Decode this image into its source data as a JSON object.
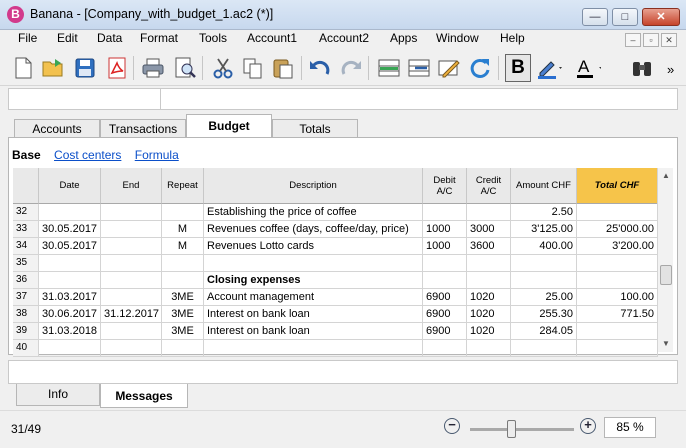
{
  "window": {
    "title": "Banana - [Company_with_budget_1.ac2 (*)]",
    "icon_letter": "B",
    "buttons": {
      "minimize": "—",
      "maximize": "□",
      "close": "✕"
    }
  },
  "menu": [
    "File",
    "Edit",
    "Data",
    "Format",
    "Tools",
    "Account1",
    "Account2",
    "Apps",
    "Window",
    "Help"
  ],
  "mdi_buttons": [
    "–",
    "▫",
    "✕"
  ],
  "toolbar": {
    "overflow": "»"
  },
  "tabs": [
    "Accounts",
    "Transactions",
    "Budget",
    "Totals"
  ],
  "active_tab": "Budget",
  "views": {
    "base": "Base",
    "links": [
      "Cost centers",
      "Formula"
    ]
  },
  "table": {
    "columns": [
      "",
      "Date",
      "End",
      "Repeat",
      "Description",
      "Debit A/C",
      "Credit A/C",
      "Amount CHF",
      "Total CHF"
    ],
    "rows": [
      [
        "32",
        "",
        "",
        "",
        "Establishing the price of coffee",
        "",
        "",
        "2.50",
        ""
      ],
      [
        "33",
        "30.05.2017",
        "",
        "M",
        "Revenues coffee (days, coffee/day, price)",
        "1000",
        "3000",
        "3'125.00",
        "25'000.00"
      ],
      [
        "34",
        "30.05.2017",
        "",
        "M",
        "Revenues Lotto cards",
        "1000",
        "3600",
        "400.00",
        "3'200.00"
      ],
      [
        "35",
        "",
        "",
        "",
        "",
        "",
        "",
        "",
        ""
      ],
      [
        "36",
        "",
        "",
        "",
        "Closing expenses",
        "",
        "",
        "",
        ""
      ],
      [
        "37",
        "31.03.2017",
        "",
        "3ME",
        "Account management",
        "6900",
        "1020",
        "25.00",
        "100.00"
      ],
      [
        "38",
        "30.06.2017",
        "31.12.2017",
        "3ME",
        "Interest on bank loan",
        "6900",
        "1020",
        "255.30",
        "771.50"
      ],
      [
        "39",
        "31.03.2018",
        "",
        "3ME",
        "Interest on bank loan",
        "6900",
        "1020",
        "284.05",
        ""
      ],
      [
        "40",
        "",
        "",
        "",
        "",
        "",
        "",
        "",
        ""
      ]
    ]
  },
  "bottom_tabs": [
    "Info",
    "Messages"
  ],
  "active_bottom_tab": "Messages",
  "status": {
    "position": "31/49",
    "zoom": "85 %",
    "zoom_level_percent": 85
  },
  "colors": {
    "total_header": "#f6c44a",
    "link": "#0b4fc9"
  }
}
